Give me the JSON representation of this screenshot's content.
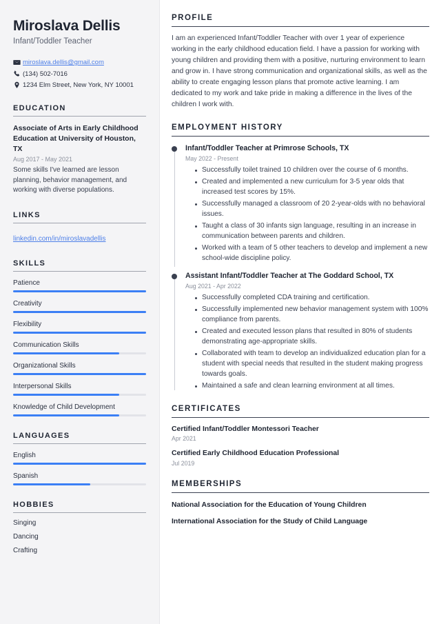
{
  "colors": {
    "accent_blue": "#3b7ff5",
    "link_blue": "#4d7fe8",
    "heading_dark": "#1f2532",
    "body_text": "#3a4050",
    "muted": "#8a8f9b",
    "sidebar_bg": "#f4f4f6",
    "bar_track": "#e2e3e8"
  },
  "sidebar": {
    "name": "Miroslava Dellis",
    "job_title": "Infant/Toddler Teacher",
    "contact": [
      {
        "icon": "envelope-icon",
        "text": "miroslava.dellis@gmail.com",
        "is_link": true
      },
      {
        "icon": "phone-icon",
        "text": "(134) 502-7016",
        "is_link": false
      },
      {
        "icon": "location-pin-icon",
        "text": "1234 Elm Street, New York, NY 10001",
        "is_link": false
      }
    ],
    "education": {
      "heading": "EDUCATION",
      "items": [
        {
          "degree": "Associate of Arts in Early Childhood Education at University of Houston, TX",
          "date": "Aug 2017 - May 2021",
          "description": "Some skills I've learned are lesson planning, behavior management, and working with diverse populations."
        }
      ]
    },
    "links": {
      "heading": "LINKS",
      "items": [
        {
          "label": "linkedin.com/in/miroslavadellis"
        }
      ]
    },
    "skills": {
      "heading": "SKILLS",
      "items": [
        {
          "label": "Patience",
          "level": 100
        },
        {
          "label": "Creativity",
          "level": 100
        },
        {
          "label": "Flexibility",
          "level": 100
        },
        {
          "label": "Communication Skills",
          "level": 80
        },
        {
          "label": "Organizational Skills",
          "level": 100
        },
        {
          "label": "Interpersonal Skills",
          "level": 80
        },
        {
          "label": "Knowledge of Child Development",
          "level": 80
        }
      ]
    },
    "languages": {
      "heading": "LANGUAGES",
      "items": [
        {
          "label": "English",
          "level": 100
        },
        {
          "label": "Spanish",
          "level": 58
        }
      ]
    },
    "hobbies": {
      "heading": "HOBBIES",
      "items": [
        {
          "label": "Singing"
        },
        {
          "label": "Dancing"
        },
        {
          "label": "Crafting"
        }
      ]
    }
  },
  "main": {
    "profile": {
      "heading": "PROFILE",
      "text": "I am an experienced Infant/Toddler Teacher with over 1 year of experience working in the early childhood education field. I have a passion for working with young children and providing them with a positive, nurturing environment to learn and grow in. I have strong communication and organizational skills, as well as the ability to create engaging lesson plans that promote active learning. I am dedicated to my work and take pride in making a difference in the lives of the children I work with."
    },
    "employment": {
      "heading": "EMPLOYMENT HISTORY",
      "jobs": [
        {
          "role": "Infant/Toddler Teacher at Primrose Schools, TX",
          "date": "May 2022 - Present",
          "bullets": [
            "Successfully toilet trained 10 children over the course of 6 months.",
            "Created and implemented a new curriculum for 3-5 year olds that increased test scores by 15%.",
            "Successfully managed a classroom of 20 2-year-olds with no behavioral issues.",
            "Taught a class of 30 infants sign language, resulting in an increase in communication between parents and children.",
            "Worked with a team of 5 other teachers to develop and implement a new school-wide discipline policy."
          ]
        },
        {
          "role": "Assistant Infant/Toddler Teacher at The Goddard School, TX",
          "date": "Aug 2021 - Apr 2022",
          "bullets": [
            "Successfully completed CDA training and certification.",
            "Successfully implemented new behavior management system with 100% compliance from parents.",
            "Created and executed lesson plans that resulted in 80% of students demonstrating age-appropriate skills.",
            "Collaborated with team to develop an individualized education plan for a student with special needs that resulted in the student making progress towards goals.",
            "Maintained a safe and clean learning environment at all times."
          ]
        }
      ]
    },
    "certificates": {
      "heading": "CERTIFICATES",
      "items": [
        {
          "title": "Certified Infant/Toddler Montessori Teacher",
          "date": "Apr 2021"
        },
        {
          "title": "Certified Early Childhood Education Professional",
          "date": "Jul 2019"
        }
      ]
    },
    "memberships": {
      "heading": "MEMBERSHIPS",
      "items": [
        {
          "label": "National Association for the Education of Young Children"
        },
        {
          "label": "International Association for the Study of Child Language"
        }
      ]
    }
  }
}
